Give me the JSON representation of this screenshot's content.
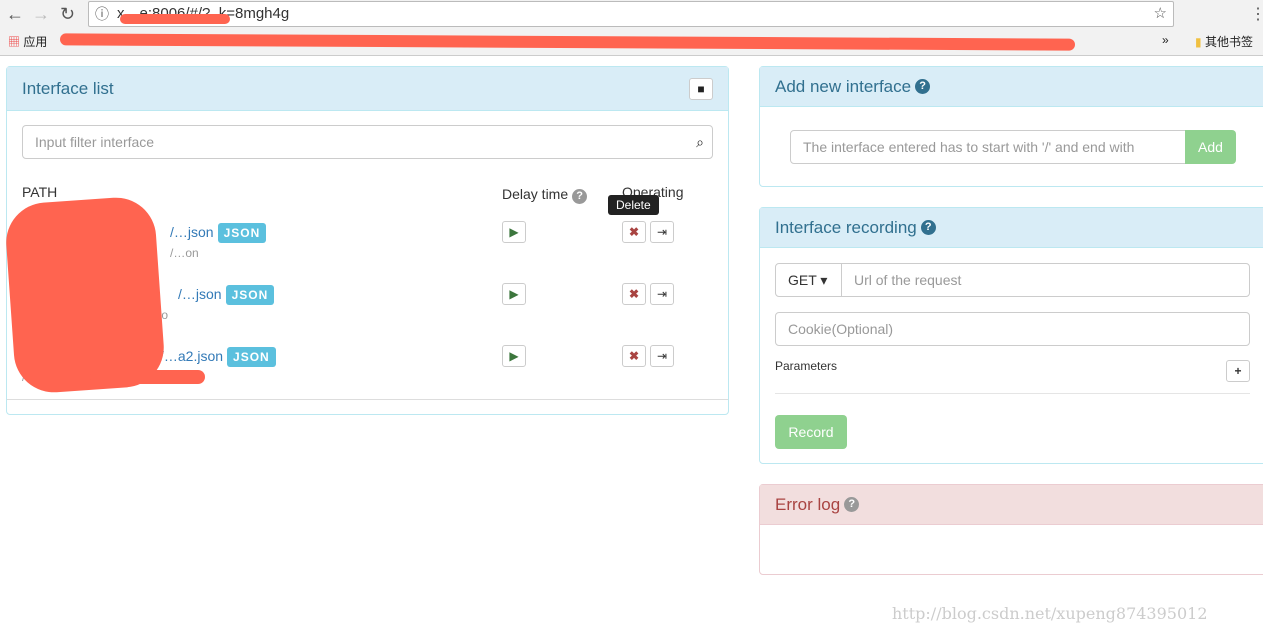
{
  "browser": {
    "url": "x…e:8006/#/?_k=8mgh4g",
    "apps_label": "应用",
    "other_bookmarks": "其他书签",
    "more": "»"
  },
  "interface_list": {
    "title": "Interface list",
    "filter_placeholder": "Input filter interface",
    "col_path": "PATH",
    "col_delay": "Delay time",
    "col_operating": "Operating",
    "tooltip": "Delete",
    "badge": "JSON",
    "rows": [
      {
        "path": "/…json",
        "sub": "/…on"
      },
      {
        "path": "/…json",
        "sub": "/…so"
      },
      {
        "path": "/…a2.json",
        "sub": "/…"
      }
    ]
  },
  "add_interface": {
    "title": "Add new interface",
    "placeholder": "The interface entered has to start with '/' and end with",
    "button": "Add"
  },
  "recording": {
    "title": "Interface recording",
    "method": "GET",
    "url_placeholder": "Url of the request",
    "cookie_placeholder": "Cookie(Optional)",
    "parameters_label": "Parameters",
    "record_button": "Record"
  },
  "error_log": {
    "title": "Error log"
  },
  "watermark": "http://blog.csdn.net/xupeng874395012"
}
